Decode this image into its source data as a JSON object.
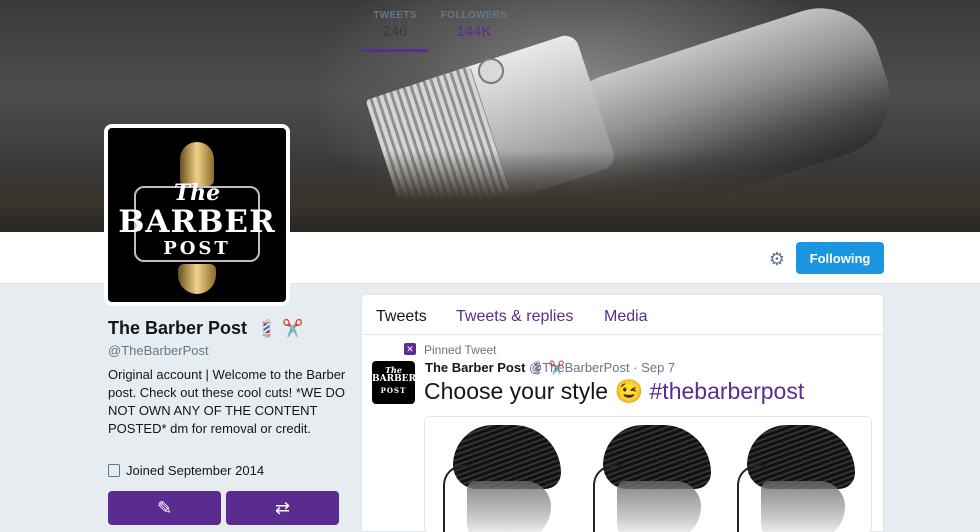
{
  "profile": {
    "name": "The Barber Post",
    "name_emoji": "💈 ✂️",
    "handle": "@TheBarberPost",
    "bio": "Original account | Welcome to the Barber post. Check out these cool cuts! *WE DO NOT OWN ANY OF THE CONTENT POSTED* dm for removal or credit.",
    "joined": "Joined September 2014",
    "avatar_logo": {
      "the": "The",
      "barber": "BARBER",
      "post": "POST"
    }
  },
  "stats": {
    "tweets_label": "TWEETS",
    "tweets_value": "246",
    "followers_label": "FOLLOWERS",
    "followers_value": "144K"
  },
  "actions": {
    "following_label": "Following",
    "settings_icon": "gear-icon",
    "tweet_to_icon": "compose-icon",
    "retweet_icon": "retweet-icon"
  },
  "timeline": {
    "tabs": [
      {
        "label": "Tweets",
        "active": true
      },
      {
        "label": "Tweets & replies",
        "active": false
      },
      {
        "label": "Media",
        "active": false
      }
    ],
    "pinned_label": "Pinned Tweet",
    "tweet": {
      "author": "The Barber Post",
      "author_emoji": "💈 ✂️",
      "meta": "@TheBarberPost · Sep 7",
      "text": "Choose your style",
      "emoji": "😉",
      "hashtag": "#thebarberpost"
    }
  },
  "colors": {
    "accent": "#5b2c8f",
    "follow_button": "#1b95e0",
    "background": "#e6ecf0"
  }
}
